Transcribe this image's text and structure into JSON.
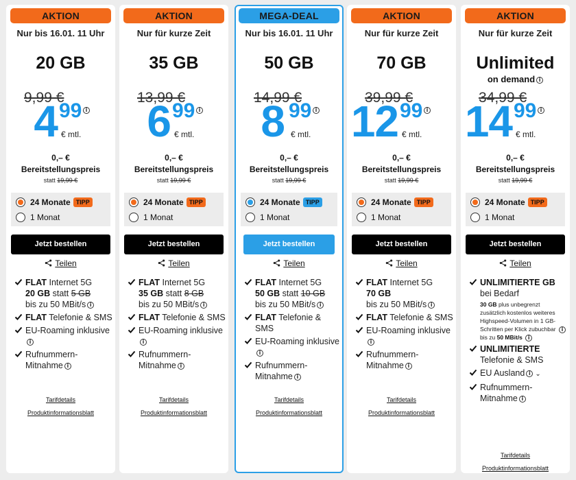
{
  "colors": {
    "accent": "#1a96e8",
    "badge_orange": "#f26a1b",
    "featured_blue": "#2b9fe6"
  },
  "share_label": "Teilen",
  "tipp_label": "TIPP",
  "links": {
    "details": "Tarifdetails",
    "info_sheet": "Produktinformationsblatt"
  },
  "cards": [
    {
      "badge": "AKTION",
      "subtitle": "Nur bis 16.01. 11 Uhr",
      "volume": "20 GB",
      "volume_sub": "",
      "old_price": "9,99 €",
      "price_int": "4",
      "price_dec": "99",
      "price_unit": "€ mtl.",
      "setup_price": "0,– €",
      "setup_label": "Bereitstellungspreis",
      "setup_old_prefix": "statt",
      "setup_old": "19,99 €",
      "term_1": "24 Monate",
      "term_2": "1 Monat",
      "order_label": "Jetzt bestellen",
      "f1_bold": "FLAT",
      "f1_rest": "Internet 5G",
      "f1_vol": "20 GB",
      "f1_statt": "statt",
      "f1_old": "5 GB",
      "f1_speed": "bis zu 50 MBit/s",
      "f2_bold": "FLAT",
      "f2_rest": "Telefonie & SMS",
      "f3": "EU-Roaming inklusive",
      "f4": "Rufnummern-Mitnahme"
    },
    {
      "badge": "AKTION",
      "subtitle": "Nur für kurze Zeit",
      "volume": "35 GB",
      "volume_sub": "",
      "old_price": "13,99 €",
      "price_int": "6",
      "price_dec": "99",
      "price_unit": "€ mtl.",
      "setup_price": "0,– €",
      "setup_label": "Bereitstellungspreis",
      "setup_old_prefix": "statt",
      "setup_old": "19,99 €",
      "term_1": "24 Monate",
      "term_2": "1 Monat",
      "order_label": "Jetzt bestellen",
      "f1_bold": "FLAT",
      "f1_rest": "Internet 5G",
      "f1_vol": "35 GB",
      "f1_statt": "statt",
      "f1_old": "8 GB",
      "f1_speed": "bis zu 50 MBit/s",
      "f2_bold": "FLAT",
      "f2_rest": "Telefonie & SMS",
      "f3": "EU-Roaming inklusive",
      "f4": "Rufnummern-Mitnahme"
    },
    {
      "badge": "MEGA-DEAL",
      "subtitle": "Nur bis 16.01. 11 Uhr",
      "volume": "50 GB",
      "volume_sub": "",
      "old_price": "14,99 €",
      "price_int": "8",
      "price_dec": "99",
      "price_unit": "€ mtl.",
      "setup_price": "0,– €",
      "setup_label": "Bereitstellungspreis",
      "setup_old_prefix": "statt",
      "setup_old": "19,99 €",
      "term_1": "24 Monate",
      "term_2": "1 Monat",
      "order_label": "Jetzt bestellen",
      "f1_bold": "FLAT",
      "f1_rest": "Internet 5G",
      "f1_vol": "50 GB",
      "f1_statt": "statt",
      "f1_old": "10 GB",
      "f1_speed": "bis zu 50 MBit/s",
      "f2_bold": "FLAT",
      "f2_rest": "Telefonie & SMS",
      "f3": "EU-Roaming inklusive",
      "f4": "Rufnummern-Mitnahme"
    },
    {
      "badge": "AKTION",
      "subtitle": "Nur für kurze Zeit",
      "volume": "70 GB",
      "volume_sub": "",
      "old_price": "39,99 €",
      "price_int": "12",
      "price_dec": "99",
      "price_unit": "€ mtl.",
      "setup_price": "0,– €",
      "setup_label": "Bereitstellungspreis",
      "setup_old_prefix": "statt",
      "setup_old": "19,99 €",
      "term_1": "24 Monate",
      "term_2": "1 Monat",
      "order_label": "Jetzt bestellen",
      "f1_bold": "FLAT",
      "f1_rest": "Internet 5G",
      "f1_vol": "70 GB",
      "f1_statt": "",
      "f1_old": "",
      "f1_speed": "bis zu 50 MBit/s",
      "f2_bold": "FLAT",
      "f2_rest": "Telefonie & SMS",
      "f3": "EU-Roaming inklusive",
      "f4": "Rufnummern-Mitnahme"
    },
    {
      "badge": "AKTION",
      "subtitle": "Nur für kurze Zeit",
      "volume": "Unlimited",
      "volume_sub": "on demand",
      "old_price": "34,99 €",
      "price_int": "14",
      "price_dec": "99",
      "price_unit": "€ mtl.",
      "setup_price": "0,– €",
      "setup_label": "Bereitstellungspreis",
      "setup_old_prefix": "statt",
      "setup_old": "19,99 €",
      "term_1": "24 Monate",
      "term_2": "1 Monat",
      "order_label": "Jetzt bestellen",
      "u1_bold": "UNLIMITIERTE GB",
      "u1_rest": "bei Bedarf",
      "u1_small_a": "30 GB",
      "u1_small_b": "plus unbegrenzt zusätzlich kostenlos weiteres Highspeed-Volumen in 1 GB-Schritten per Klick zubuchbar",
      "u1_small_c": "bis zu",
      "u1_small_d": "50 MBit/s",
      "u2_bold": "UNLIMITIERTE",
      "u2_rest": "Telefonie & SMS",
      "u3": "EU Ausland",
      "u4": "Rufnummern-Mitnahme"
    }
  ]
}
